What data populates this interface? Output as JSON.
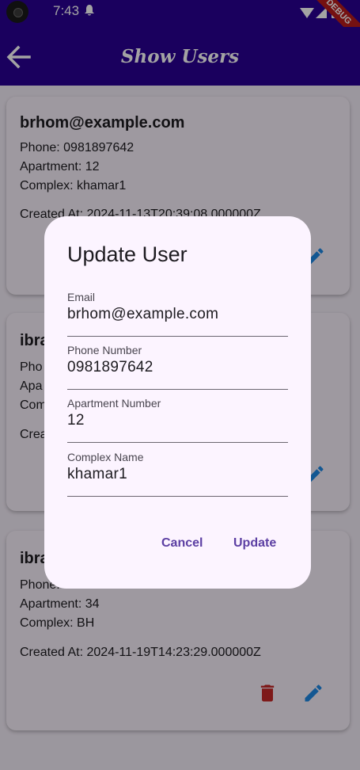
{
  "status_bar": {
    "time": "7:43",
    "debug_label": "DEBUG"
  },
  "app_bar": {
    "title": "Show Users"
  },
  "users": [
    {
      "email": "brhom@example.com",
      "phone": "Phone: 0981897642",
      "apartment": "Apartment: 12",
      "complex": "Complex: khamar1",
      "created": "Created At: 2024-11-13T20:39:08.000000Z"
    },
    {
      "email": "ibra",
      "phone": "Pho",
      "apartment": "Apa",
      "complex": "Com",
      "created": "Crea"
    },
    {
      "email": "ibra",
      "phone": "Phone:",
      "apartment": "Apartment: 34",
      "complex": "Complex: BH",
      "created": "Created At: 2024-11-19T14:23:29.000000Z"
    }
  ],
  "dialog": {
    "title": "Update User",
    "fields": [
      {
        "label": "Email",
        "value": "brhom@example.com"
      },
      {
        "label": "Phone Number",
        "value": "0981897642"
      },
      {
        "label": "Apartment Number",
        "value": "12"
      },
      {
        "label": "Complex Name",
        "value": "khamar1"
      }
    ],
    "cancel_label": "Cancel",
    "update_label": "Update"
  },
  "colors": {
    "app_bar": "#2a0094",
    "delete": "#c62828",
    "edit": "#1e88e5",
    "dialog_button": "#5c3fa3"
  },
  "icons": [
    "camera-icon",
    "bell-icon",
    "wifi-icon",
    "signal-icon",
    "battery-icon",
    "back-arrow-icon",
    "delete-icon",
    "edit-icon"
  ]
}
